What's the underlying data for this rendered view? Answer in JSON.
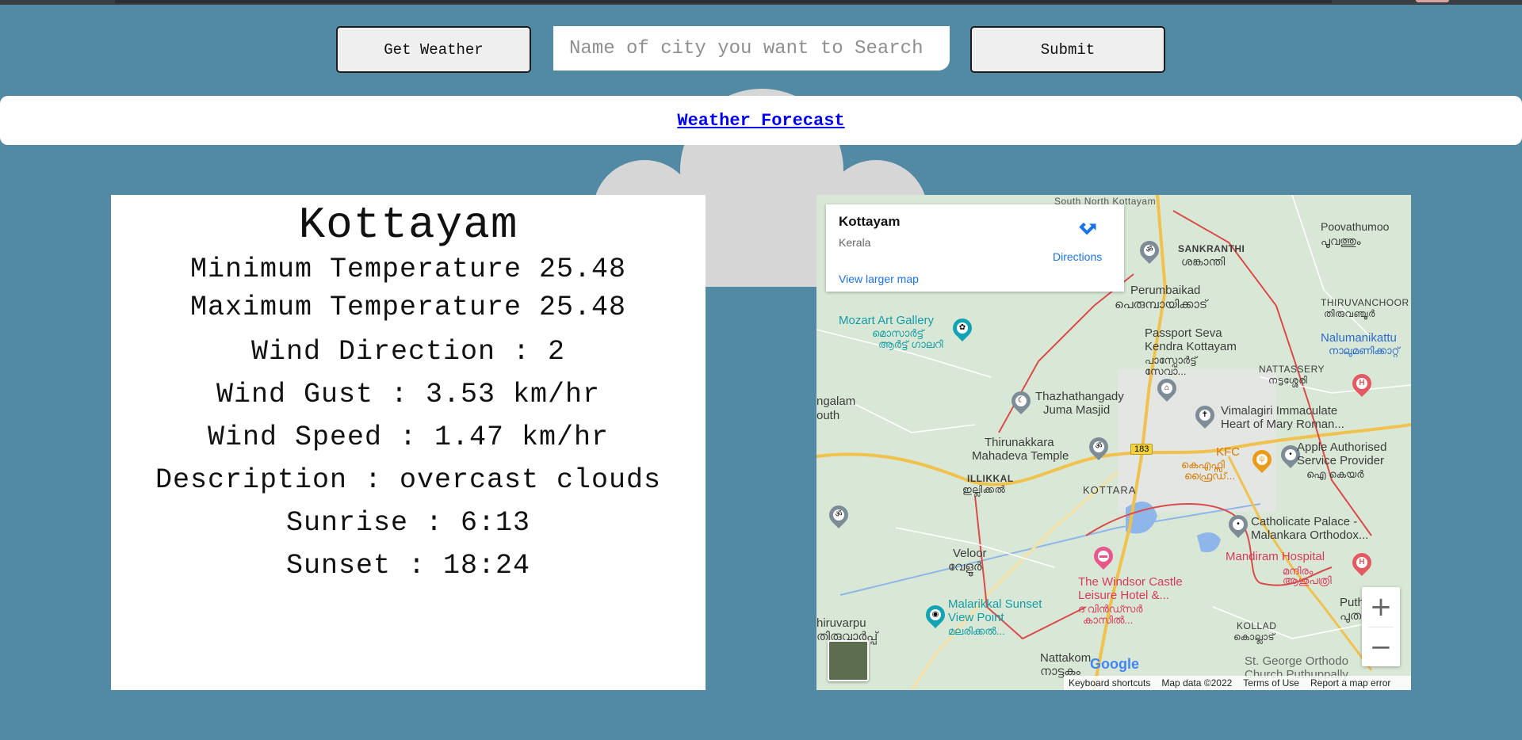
{
  "toolbar": {
    "get_weather_label": "Get Weather",
    "search_placeholder": "Name of city you want to Search",
    "search_value": "",
    "submit_label": "Submit"
  },
  "forecast_link": "Weather Forecast",
  "weather": {
    "city": "Kottayam",
    "min_temp": "Minimum Temperature 25.48",
    "max_temp": "Maximum Temperature 25.48",
    "wind_direction": "Wind Direction : 2",
    "wind_gust": "Wind Gust : 3.53 km/hr",
    "wind_speed": "Wind Speed : 1.47 km/hr",
    "description": "Description : overcast clouds",
    "sunrise": "Sunrise : 6:13",
    "sunset": "Sunset : 18:24"
  },
  "map": {
    "place_title": "Kottayam",
    "place_subtitle": "Kerala",
    "directions_label": "Directions",
    "view_larger_label": "View larger map",
    "zoom_in": "+",
    "zoom_out": "−",
    "google_logo": "Google",
    "attribution": {
      "shortcuts": "Keyboard shortcuts",
      "data": "Map data ©2022",
      "terms": "Terms of Use",
      "report": "Report a map error"
    },
    "labels": {
      "poovathumoo": "Poovathumoo",
      "poovathumoo_ml": "പൂവത്തും",
      "sankranthi": "SANKRANTHI",
      "sankranthi_ml": "ശങ്കാന്തി",
      "perumbaikad": "Perumbaikad",
      "perumbaikad_ml": "പെരുമ്പായിക്കാട്",
      "thiruvanchoor": "THIRUVANCHOOR",
      "thiruvanchoor_ml": "തിരുവഞ്ചൂർ",
      "mozart": "Mozart Art Gallery",
      "mozart_ml1": "മൊസാർട്ട്",
      "mozart_ml2": "ആർട്ട് ഗാലറി",
      "passport1": "Passport Seva",
      "passport2": "Kendra Kottayam",
      "passport_ml1": "പാസ്പോർട്ട്",
      "passport_ml2": "സേവാ...",
      "nalumanikattu": "Nalumanikattu",
      "nalumanikattu_ml": "നാലുമണിക്കാറ്റ്",
      "nattassery": "NATTASSERY",
      "nattassery_ml": "നട്ടശ്ശേരി",
      "ngalam": "ngalam",
      "outh": "outh",
      "thazhath1": "Thazhathangady",
      "thazhath2": "Juma Masjid",
      "vimalagiri1": "Vimalagiri Immaculate",
      "vimalagiri2": "Heart of Mary Roman...",
      "thirunakkara1": "Thirunakkara",
      "thirunakkara2": "Mahadeva Temple",
      "road183": "183",
      "kfc": "KFC",
      "kfc_ml": "കെഎഫ്സി",
      "kfc_ml2": "ഫ്രൈഡ്...",
      "apple1": "Apple Authorised",
      "apple2": "Service Provider",
      "apple_ml": "ഐ കെയർ",
      "illikkal": "ILLIKKAL",
      "illikkal_ml": "ഇല്ലിക്കൽ",
      "kottara": "KOTTARA",
      "catholicate1": "Catholicate Palace -",
      "catholicate2": "Malankara Orthodox...",
      "veloor": "Veloor",
      "veloor_ml": "വേളൂർ",
      "mandiram": "Mandiram Hospital",
      "mandiram_ml1": "മന്ദിരം",
      "mandiram_ml2": "ആശുപത്രി",
      "windsor1": "The Windsor Castle",
      "windsor2": "Leisure Hotel &...",
      "windsor_ml1": "ദ വിൻഡ്സർ",
      "windsor_ml2": "കാസിൽ...",
      "malarikkal1": "Malarikkal Sunset",
      "malarikkal2": "View Point",
      "malarikkal_ml": "മലരിക്കൽ...",
      "thiruvarpu": "hiruvarpu",
      "thiruvarpu_ml": "തിരുവാർപ്പ്",
      "kollad": "KOLLAD",
      "kollad_ml": "കൊല്ലാട്",
      "nattakom": "Nattakom",
      "nattakom_ml": "നാട്ടകം",
      "stgeorge1": "St. George Orthodo",
      "stgeorge2": "Church Puthuppally",
      "puth": "Puth",
      "puth_ml": "പുത",
      "soft_north": "South North Kottayam"
    }
  }
}
